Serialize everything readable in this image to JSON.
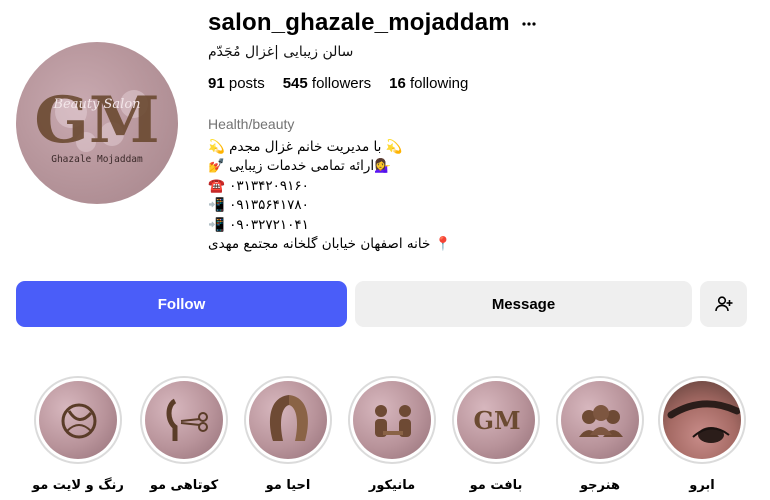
{
  "profile": {
    "username": "salon_ghazale_mojaddam",
    "more_icon": "more-horizontal-icon",
    "full_name": "سالن زیبایی |غزال مُجَدّم",
    "avatar_text_monogram": "GM",
    "avatar_text_script": "Beauty Salon",
    "avatar_text_name": "Ghazale Mojaddam"
  },
  "stats": {
    "posts_count": "91",
    "posts_label": "posts",
    "followers_count": "545",
    "followers_label": "followers",
    "following_count": "16",
    "following_label": "following"
  },
  "bio": {
    "category": "Health/beauty",
    "lines": [
      "💫 با مدیریت خانم غزال مجدم 💫",
      "💁‍♀️ارائه تمامی خدمات زیبایی 💅",
      "☎️ ۰۳۱۳۴۲۰۹۱۶۰",
      "📲 ۰۹۱۳۵۶۴۱۷۸۰",
      "📲 ۰۹۰۳۲۷۲۱۰۴۱",
      "📍 خانه اصفهان خیابان گلخانه مجتمع مهدی"
    ]
  },
  "actions": {
    "follow_label": "Follow",
    "message_label": "Message",
    "add_user_icon": "add-user-icon",
    "follow_color": "#4a5df9"
  },
  "highlights": [
    {
      "label": "ابرو"
    },
    {
      "label": "هنرجو"
    },
    {
      "label": "بافت مو"
    },
    {
      "label": "مانیکور"
    },
    {
      "label": "احیا مو"
    },
    {
      "label": "کوتاهی مو"
    },
    {
      "label": "رنگ و لایت مو"
    }
  ]
}
